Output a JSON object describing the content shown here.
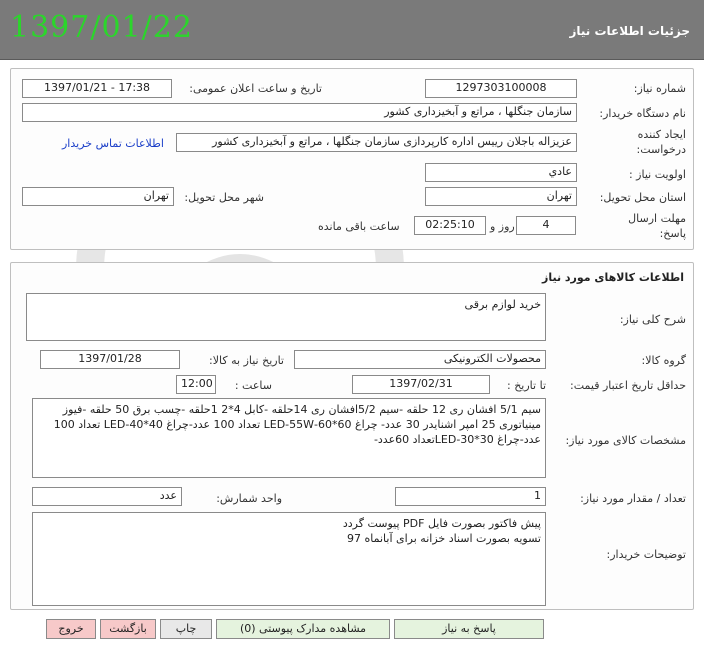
{
  "header": {
    "title": "جزئیات اطلاعات نیاز",
    "date": "1397/01/22"
  },
  "info": {
    "need_number_label": "شماره نیاز:",
    "need_number": "1297303100008",
    "announce_label": "تاریخ و ساعت اعلان عمومی:",
    "announce_value": "1397/01/21 - 17:38",
    "buyer_org_label": "نام دستگاه خریدار:",
    "buyer_org": "سازمان جنگلها ، مراتع و آبخیزداری کشور",
    "requester_label_1": "ایجاد کننده",
    "requester_label_2": "درخواست:",
    "requester": "عزیزاله باجلان رییس اداره کارپردازی سازمان جنگلها ، مراتع و آبخیزداری کشور",
    "contact_link": "اطلاعات تماس خریدار",
    "priority_label": "اولویت نیاز :",
    "priority": "عادي",
    "province_label": "استان محل تحویل:",
    "province": "تهران",
    "city_label": "شهر محل تحویل:",
    "city": "تهران",
    "deadline_label_1": "مهلت ارسال",
    "deadline_label_2": "پاسخ:",
    "days": "4",
    "days_label": "روز و",
    "time_left": "02:25:10",
    "time_left_label": "ساعت باقی مانده"
  },
  "goods": {
    "section_title": "اطلاعات کالاهای مورد نیاز",
    "summary_label": "شرح کلی نیاز:",
    "summary": "خرید لوازم برقی",
    "group_label": "گروه کالا:",
    "group": "محصولات الکترونیکی",
    "need_date_label": "تاریخ نیاز به کالا:",
    "need_date": "1397/01/28",
    "validity_label": "حداقل تاریخ اعتبار قیمت:",
    "until_label": "تا تاریخ :",
    "validity_date": "1397/02/31",
    "time_label": "ساعت :",
    "validity_time": "12:00",
    "specs_label": "مشخصات کالای مورد نیاز:",
    "specs": "سیم 5/1 افشان ری 12 حلقه -سیم 5/2افشان ری 14حلقه -کابل 4*2 1حلقه -چسب برق 50 حلقه -فیوز مینیاتوری 25 امپر اشنایدر 30 عدد- چراغ 60*60-LED-55W تعداد 100 عدد-چراغ 40*40-LED تعداد 100 عدد-چراغ 30*30-LEDتعداد 60عدد-",
    "qty_label": "تعداد / مقدار مورد نیاز:",
    "qty": "1",
    "unit_label": "واحد شمارش:",
    "unit": "عدد",
    "buyer_notes_label": "توضیحات خریدار:",
    "buyer_notes": "پیش فاکتور بصورت فایل PDF پیوست گردد\nتسویه بصورت اسناد خزانه برای آبانماه 97"
  },
  "footer": {
    "reply": "پاسخ به نیاز",
    "attachments": "مشاهده مدارک پیوستی (0)",
    "print": "چاپ",
    "back": "بازگشت",
    "exit": "خروج"
  },
  "colors": {
    "header_bg": "#7a7a7a",
    "date_green": "#2bd62b",
    "link_blue": "#1a3ec8"
  }
}
